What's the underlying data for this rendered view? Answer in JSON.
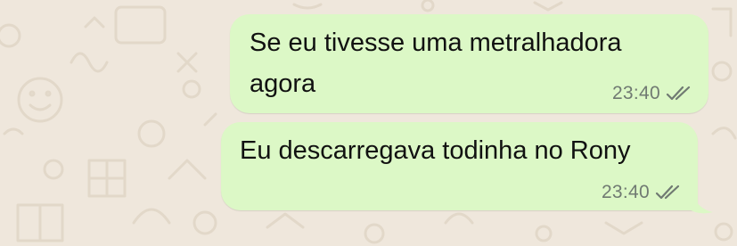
{
  "chat": {
    "messages": [
      {
        "text": "Se eu tivesse uma metralhadora\nagora",
        "time": "23:40",
        "status_icon": "double-check-icon",
        "direction": "outgoing"
      },
      {
        "text": "Eu descarregava todinha no Rony",
        "time": "23:40",
        "status_icon": "double-check-icon",
        "direction": "outgoing"
      }
    ]
  },
  "colors": {
    "wallpaper": "#efe7dc",
    "wallpaper_doodle": "#e2d8c9",
    "outgoing_bubble": "#dcf8c6",
    "text": "#111111",
    "meta": "#707a72",
    "ticks": "#707a72"
  }
}
